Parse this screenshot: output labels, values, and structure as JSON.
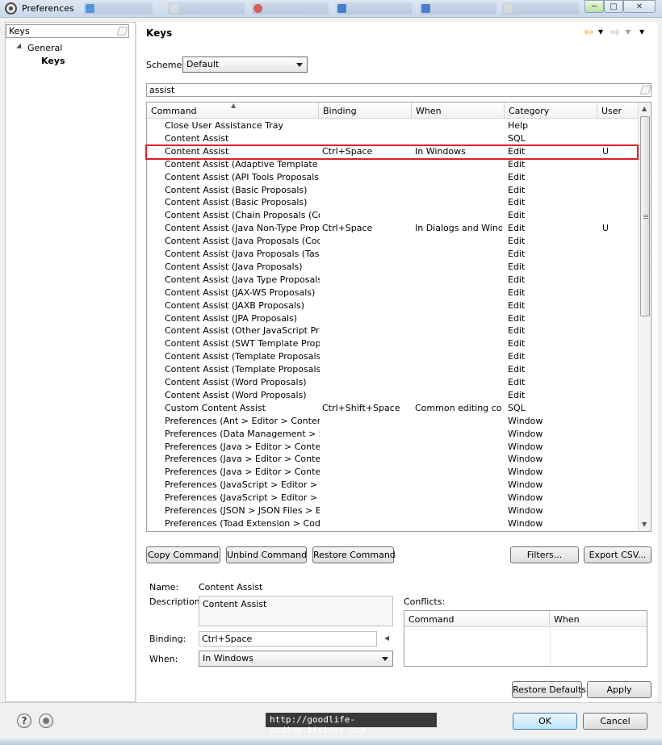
{
  "window": {
    "title": "Preferences",
    "controls": {
      "minimize": "─",
      "maximize": "□",
      "close": "✕"
    }
  },
  "taskbar_thumbs": [
    {
      "color": "#3c8ad8"
    },
    {
      "color": "#d9d9d9"
    },
    {
      "color": "#d24a3a"
    },
    {
      "color": "#2f6fc8"
    },
    {
      "color": "#2f6fc8"
    },
    {
      "color": "#d9d9d9"
    }
  ],
  "sidebar": {
    "filter_value": "Keys",
    "items": [
      {
        "label": "General"
      },
      {
        "label": "Keys"
      }
    ]
  },
  "page": {
    "title": "Keys",
    "scheme_label": "Scheme:",
    "scheme_value": "Default",
    "filter_value": "assist"
  },
  "table": {
    "headers": {
      "command": "Command",
      "binding": "Binding",
      "when": "When",
      "category": "Category",
      "user": "User"
    },
    "highlighted_row": 2,
    "rows": [
      {
        "command": "Close User Assistance Tray",
        "binding": "",
        "when": "",
        "category": "Help",
        "user": ""
      },
      {
        "command": "Content Assist",
        "binding": "",
        "when": "",
        "category": "SQL",
        "user": ""
      },
      {
        "command": "Content Assist",
        "binding": "Ctrl+Space",
        "when": "In Windows",
        "category": "Edit",
        "user": "U"
      },
      {
        "command": "Content Assist (Adaptive Template Prop",
        "binding": "",
        "when": "",
        "category": "Edit",
        "user": ""
      },
      {
        "command": "Content Assist (API Tools Proposals)",
        "binding": "",
        "when": "",
        "category": "Edit",
        "user": ""
      },
      {
        "command": "Content Assist (Basic Proposals)",
        "binding": "",
        "when": "",
        "category": "Edit",
        "user": ""
      },
      {
        "command": "Content Assist (Basic Proposals)",
        "binding": "",
        "when": "",
        "category": "Edit",
        "user": ""
      },
      {
        "command": "Content Assist (Chain Proposals (Code R",
        "binding": "",
        "when": "",
        "category": "Edit",
        "user": ""
      },
      {
        "command": "Content Assist (Java Non-Type Proposals",
        "binding": "Ctrl+Space",
        "when": "In Dialogs and Wind...",
        "category": "Edit",
        "user": "U"
      },
      {
        "command": "Content Assist (Java Proposals (Code Re",
        "binding": "",
        "when": "",
        "category": "Edit",
        "user": ""
      },
      {
        "command": "Content Assist (Java Proposals (Task-Foc",
        "binding": "",
        "when": "",
        "category": "Edit",
        "user": ""
      },
      {
        "command": "Content Assist (Java Proposals)",
        "binding": "",
        "when": "",
        "category": "Edit",
        "user": ""
      },
      {
        "command": "Content Assist (Java Type Proposals)",
        "binding": "",
        "when": "",
        "category": "Edit",
        "user": ""
      },
      {
        "command": "Content Assist (JAX-WS Proposals)",
        "binding": "",
        "when": "",
        "category": "Edit",
        "user": ""
      },
      {
        "command": "Content Assist (JAXB Proposals)",
        "binding": "",
        "when": "",
        "category": "Edit",
        "user": ""
      },
      {
        "command": "Content Assist (JPA Proposals)",
        "binding": "",
        "when": "",
        "category": "Edit",
        "user": ""
      },
      {
        "command": "Content Assist (Other JavaScript Propos",
        "binding": "",
        "when": "",
        "category": "Edit",
        "user": ""
      },
      {
        "command": "Content Assist (SWT Template Proposals",
        "binding": "",
        "when": "",
        "category": "Edit",
        "user": ""
      },
      {
        "command": "Content Assist (Template Proposals)",
        "binding": "",
        "when": "",
        "category": "Edit",
        "user": ""
      },
      {
        "command": "Content Assist (Template Proposals)",
        "binding": "",
        "when": "",
        "category": "Edit",
        "user": ""
      },
      {
        "command": "Content Assist (Word Proposals)",
        "binding": "",
        "when": "",
        "category": "Edit",
        "user": ""
      },
      {
        "command": "Content Assist (Word Proposals)",
        "binding": "",
        "when": "",
        "category": "Edit",
        "user": ""
      },
      {
        "command": "Custom Content Assist",
        "binding": "Ctrl+Shift+Space",
        "when": "Common editing co...",
        "category": "SQL",
        "user": ""
      },
      {
        "command": "Preferences (Ant > Editor > Content Ass",
        "binding": "",
        "when": "",
        "category": "Window",
        "user": ""
      },
      {
        "command": "Preferences (Data Management > SQL D",
        "binding": "",
        "when": "",
        "category": "Window",
        "user": ""
      },
      {
        "command": "Preferences (Java > Editor > Content As",
        "binding": "",
        "when": "",
        "category": "Window",
        "user": ""
      },
      {
        "command": "Preferences (Java > Editor > Content As",
        "binding": "",
        "when": "",
        "category": "Window",
        "user": ""
      },
      {
        "command": "Preferences (Java > Editor > Content As",
        "binding": "",
        "when": "",
        "category": "Window",
        "user": ""
      },
      {
        "command": "Preferences (JavaScript > Editor > Conte",
        "binding": "",
        "when": "",
        "category": "Window",
        "user": ""
      },
      {
        "command": "Preferences (JavaScript > Editor > Conte",
        "binding": "",
        "when": "",
        "category": "Window",
        "user": ""
      },
      {
        "command": "Preferences (JSON > JSON Files > Editor",
        "binding": "",
        "when": "",
        "category": "Window",
        "user": ""
      },
      {
        "command": "Preferences (Toad Extension > Code Ass",
        "binding": "",
        "when": "",
        "category": "Window",
        "user": ""
      }
    ]
  },
  "buttons": {
    "copy_command": "Copy Command",
    "unbind_command": "Unbind Command",
    "restore_command": "Restore Command",
    "filters": "Filters...",
    "export_csv": "Export CSV...",
    "restore_defaults": "Restore Defaults",
    "apply": "Apply",
    "ok": "OK",
    "cancel": "Cancel"
  },
  "details": {
    "name_label": "Name:",
    "name_value": "Content Assist",
    "description_label": "Description:",
    "description_value": "Content Assist",
    "binding_label": "Binding:",
    "binding_value": "Ctrl+Space",
    "when_label": "When:",
    "when_value": "In Windows",
    "conflicts_label": "Conflicts:",
    "conflicts_headers": {
      "command": "Command",
      "when": "When"
    }
  },
  "footer": {
    "help_icon": "?",
    "watermark": "http://goodlife-coding.tistory.com"
  },
  "colors": {
    "highlight_border": "#e0202a",
    "default_button_border": "#3c7fb1"
  }
}
